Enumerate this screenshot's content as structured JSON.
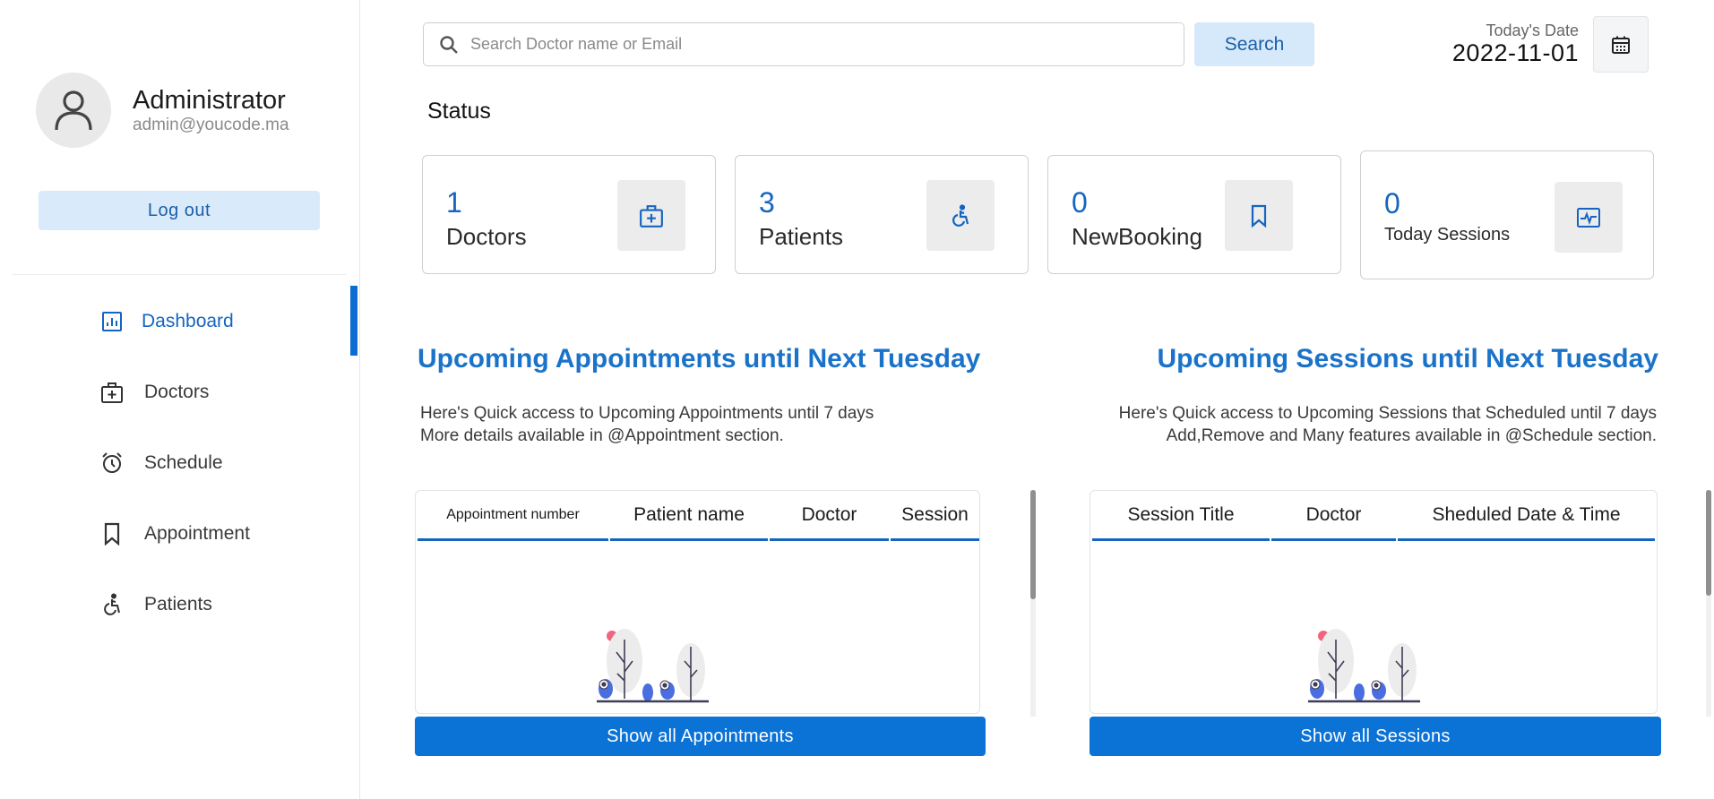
{
  "profile": {
    "name": "Administrator",
    "email": "admin@youcode.ma",
    "logout_label": "Log out"
  },
  "nav": [
    {
      "label": "Dashboard",
      "icon": "dashboard-icon",
      "active": true
    },
    {
      "label": "Doctors",
      "icon": "medical-case-icon",
      "active": false
    },
    {
      "label": "Schedule",
      "icon": "alarm-clock-icon",
      "active": false
    },
    {
      "label": "Appointment",
      "icon": "bookmark-icon",
      "active": false
    },
    {
      "label": "Patients",
      "icon": "accessible-icon",
      "active": false
    }
  ],
  "search": {
    "placeholder": "Search Doctor name or Email",
    "button_label": "Search"
  },
  "date": {
    "label": "Today's Date",
    "value": "2022-11-01"
  },
  "status": {
    "title": "Status",
    "cards": [
      {
        "count": "1",
        "label": "Doctors",
        "icon": "medical-case-icon"
      },
      {
        "count": "3",
        "label": "Patients",
        "icon": "accessible-icon"
      },
      {
        "count": "0",
        "label": "NewBooking",
        "icon": "bookmark-icon"
      },
      {
        "count": "0",
        "label": "Today Sessions",
        "icon": "pulse-icon"
      }
    ]
  },
  "appointments": {
    "title": "Upcoming Appointments until Next Tuesday",
    "desc_line1": "Here's Quick access to Upcoming Appointments until 7 days",
    "desc_line2": "More details available in @Appointment section.",
    "columns": [
      "Appointment number",
      "Patient name",
      "Doctor",
      "Session"
    ],
    "button_label": "Show all Appointments"
  },
  "sessions": {
    "title": "Upcoming Sessions until Next Tuesday",
    "desc_line1": "Here's Quick access to Upcoming Sessions that Scheduled until 7 days",
    "desc_line2": "Add,Remove and Many features available in @Schedule section.",
    "columns": [
      "Session Title",
      "Doctor",
      "Sheduled Date & Time"
    ],
    "button_label": "Show all Sessions"
  },
  "colors": {
    "accent": "#1565c0",
    "button": "#0b72d6",
    "light_button": "#d6e9fa"
  }
}
